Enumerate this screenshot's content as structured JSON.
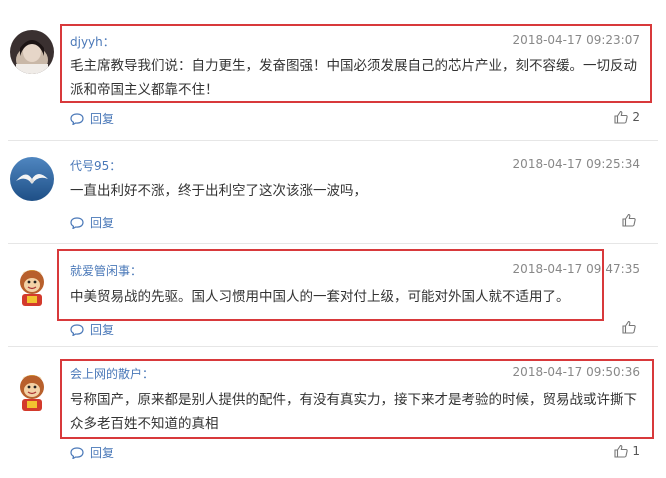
{
  "comments": [
    {
      "username": "djyyh：",
      "timestamp": "2018-04-17 09:23:07",
      "content_line1": "毛主席教导我们说：自力更生，发奋图强！中国必须发展自己的芯片产业，刻不容缓。一切反动",
      "content_line2": "派和帝国主义都靠不住！",
      "reply_label": "回复",
      "likes": "2",
      "avatar_icon": "portrait-avatar-icon"
    },
    {
      "username": "代号95：",
      "timestamp": "2018-04-17 09:25:34",
      "content_line1": "一直出利好不涨，终于出利空了这次该涨一波吗，",
      "reply_label": "回复",
      "likes": "",
      "avatar_icon": "seagull-avatar-icon"
    },
    {
      "username": "就爱管闲事：",
      "timestamp": "2018-04-17 09:47:35",
      "content_line1": "中美贸易战的先驱。国人习惯用中国人的一套对付上级，可能对外国人就不适用了。",
      "reply_label": "回复",
      "likes": "",
      "avatar_icon": "monkey-avatar-icon"
    },
    {
      "username": "会上网的散户：",
      "timestamp": "2018-04-17 09:50:36",
      "content_line1": "号称国产，原来都是别人提供的配件，有没有真实力，接下来才是考验的时候，贸易战或许撕下",
      "content_line2": "众多老百姓不知道的真相",
      "reply_label": "回复",
      "likes": "1",
      "avatar_icon": "monkey-avatar-icon"
    }
  ],
  "colors": {
    "username": "#4a78b8",
    "highlight": "#d8393b",
    "timestamp": "#888888"
  }
}
